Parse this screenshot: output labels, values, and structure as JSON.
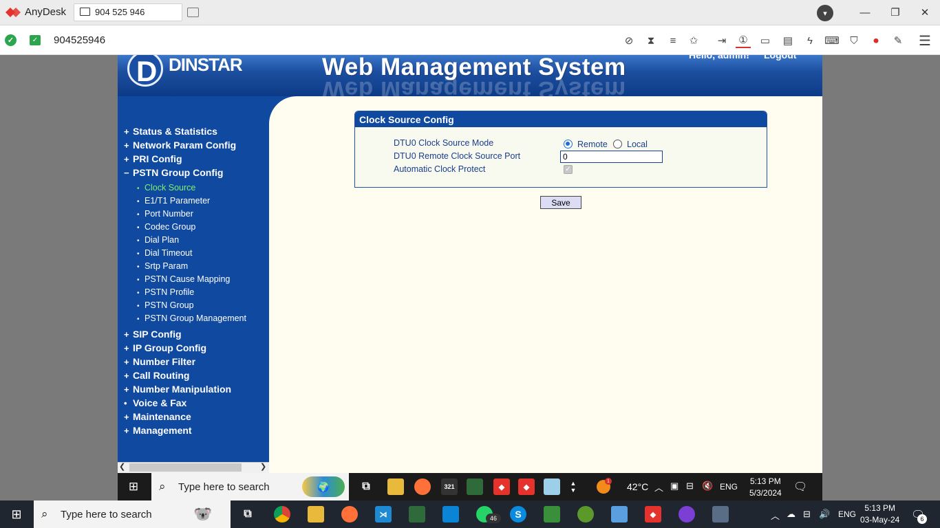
{
  "anydesk": {
    "app_name": "AnyDesk",
    "tab_label": "904 525 946",
    "address_value": "904525946",
    "menu_glyph": "▾"
  },
  "remote": {
    "header": {
      "logo_text": "DINSTAR",
      "logo_letter": "D",
      "title": "Web Management System",
      "greeting": "Hello, admin!",
      "logout": "Logout"
    },
    "sidebar": {
      "menu": [
        {
          "label": "Status & Statistics",
          "marker": "+"
        },
        {
          "label": "Network Param Config",
          "marker": "+"
        },
        {
          "label": "PRI Config",
          "marker": "+"
        },
        {
          "label": "PSTN Group Config",
          "marker": "−"
        }
      ],
      "submenu": [
        {
          "label": "Clock Source",
          "active": true
        },
        {
          "label": "E1/T1 Parameter"
        },
        {
          "label": "Port Number"
        },
        {
          "label": "Codec Group"
        },
        {
          "label": "Dial Plan"
        },
        {
          "label": "Dial Timeout"
        },
        {
          "label": "Srtp Param"
        },
        {
          "label": "PSTN Cause Mapping"
        },
        {
          "label": "PSTN Profile"
        },
        {
          "label": "PSTN Group"
        },
        {
          "label": "PSTN Group Management"
        }
      ],
      "menu_after": [
        {
          "label": "SIP Config",
          "marker": "+"
        },
        {
          "label": "IP Group Config",
          "marker": "+"
        },
        {
          "label": "Number Filter",
          "marker": "+"
        },
        {
          "label": "Call Routing",
          "marker": "+"
        },
        {
          "label": "Number Manipulation",
          "marker": "+"
        },
        {
          "label": "Voice & Fax",
          "marker": "•"
        },
        {
          "label": "Maintenance",
          "marker": "+"
        },
        {
          "label": "Management",
          "marker": "+"
        }
      ]
    },
    "panel": {
      "title": "Clock Source Config",
      "mode_label": "DTU0 Clock Source Mode",
      "mode_options": [
        "Remote",
        "Local"
      ],
      "mode_selected": "Remote",
      "port_label": "DTU0 Remote Clock Source Port",
      "port_value": "0",
      "protect_label": "Automatic Clock Protect",
      "protect_checked": true,
      "save_label": "Save"
    },
    "taskbar": {
      "search_placeholder": "Type here to search",
      "temperature": "42°C",
      "weather_badge": "1",
      "lang": "ENG",
      "time": "5:13 PM",
      "date": "5/3/2024",
      "icons": [
        "task-view-icon",
        "file-explorer-icon",
        "firefox-icon",
        "calendar-icon",
        "snipping-tool-icon",
        "anydesk-icon",
        "anydesk-icon-2",
        "notepad-icon"
      ]
    }
  },
  "local_taskbar": {
    "search_placeholder": "Type here to search",
    "whatsapp_badge": "46",
    "lang": "ENG",
    "time": "5:13 PM",
    "date": "03-May-24",
    "notification_count": "6"
  },
  "colors": {
    "sidebar_bg": "#0f49a0",
    "active_submenu": "#7cf26b",
    "content_bg": "#fffdf0"
  }
}
